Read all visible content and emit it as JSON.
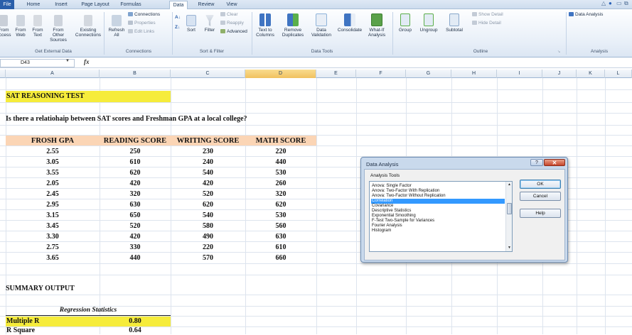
{
  "ribbon_tabs": [
    "File",
    "Home",
    "Insert",
    "Page Layout",
    "Formulas",
    "Data",
    "Review",
    "View"
  ],
  "ribbon": {
    "get_external": {
      "buttons": [
        "From Access",
        "From Web",
        "From Text",
        "From Other Sources",
        "Existing Connections"
      ],
      "label": "Get External Data"
    },
    "connections": {
      "refresh": "Refresh All",
      "connections": "Connections",
      "properties": "Properties",
      "edit_links": "Edit Links",
      "label": "Connections"
    },
    "sort_filter": {
      "sort": "Sort",
      "filter": "Filter",
      "clear": "Clear",
      "reapply": "Reapply",
      "advanced": "Advanced",
      "label": "Sort & Filter"
    },
    "data_tools": {
      "text_to_columns": "Text to Columns",
      "remove_duplicates": "Remove Duplicates",
      "data_validation": "Data Validation",
      "consolidate": "Consolidate",
      "what_if": "What-If Analysis",
      "label": "Data Tools"
    },
    "outline": {
      "group": "Group",
      "ungroup": "Ungroup",
      "subtotal": "Subtotal",
      "show_detail": "Show Detail",
      "hide_detail": "Hide Detail",
      "label": "Outline"
    },
    "analysis": {
      "data_analysis": "Data Analysis",
      "label": "Analysis"
    }
  },
  "formula_bar": {
    "name_box": "D43",
    "fx": "fx",
    "formula": ""
  },
  "columns": [
    "A",
    "B",
    "C",
    "D",
    "E",
    "F",
    "G",
    "H",
    "I",
    "J",
    "K",
    "L"
  ],
  "sheet": {
    "title": "SAT REASONING TEST",
    "question": "Is there a relatiohaip between SAT scores and Freshman GPA at a local college?",
    "headers": [
      "FROSH GPA",
      "READING SCORE",
      "WRITING SCORE",
      "MATH SCORE"
    ],
    "rows": [
      [
        "2.55",
        "250",
        "230",
        "220"
      ],
      [
        "3.05",
        "610",
        "240",
        "440"
      ],
      [
        "3.55",
        "620",
        "540",
        "530"
      ],
      [
        "2.05",
        "420",
        "420",
        "260"
      ],
      [
        "2.45",
        "320",
        "520",
        "320"
      ],
      [
        "2.95",
        "630",
        "620",
        "620"
      ],
      [
        "3.15",
        "650",
        "540",
        "530"
      ],
      [
        "3.45",
        "520",
        "580",
        "560"
      ],
      [
        "3.30",
        "420",
        "490",
        "630"
      ],
      [
        "2.75",
        "330",
        "220",
        "610"
      ],
      [
        "3.65",
        "440",
        "570",
        "660"
      ]
    ],
    "summary_title": "SUMMARY OUTPUT",
    "regression_header": "Regression Statistics",
    "multiple_r_label": "Multiple R",
    "multiple_r_value": "0.80",
    "r_square_label": "R Square",
    "r_square_value": "0.64"
  },
  "dialog": {
    "title": "Data Analysis",
    "help_glyph": "?",
    "close_glyph": "✕",
    "list_label": "Analysis Tools",
    "items": [
      "Anova: Single Factor",
      "Anova: Two-Factor With Replication",
      "Anova: Two-Factor Without Replication",
      "Correlation",
      "Covariance",
      "Descriptive Statistics",
      "Exponential Smoothing",
      "F-Test Two-Sample for Variances",
      "Fourier Analysis",
      "Histogram"
    ],
    "selected_index": 3,
    "ok": "OK",
    "cancel": "Cancel",
    "help": "Help"
  }
}
